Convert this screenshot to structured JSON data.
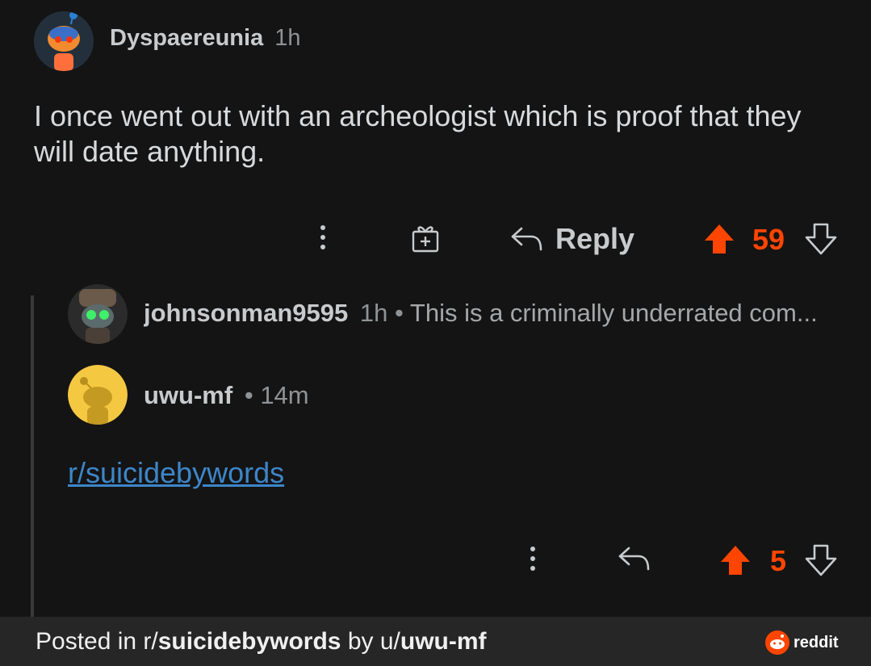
{
  "comment": {
    "author": "Dyspaereunia",
    "time": "1h",
    "body": "I once went out with an archeologist which is proof that they will date anything.",
    "reply_label": "Reply",
    "score": "59"
  },
  "collapsed_reply": {
    "author": "johnsonman9595",
    "time": "1h",
    "separator": "•",
    "preview": "This is a criminally underrated com..."
  },
  "reply": {
    "author": "uwu-mf",
    "separator": "•",
    "time": "14m",
    "link_text": "r/suicidebywords",
    "score": "5"
  },
  "footer": {
    "posted_in": "Posted in r/",
    "subreddit": "suicidebywords",
    "by": "by u/",
    "user": "uwu-mf",
    "brand": "reddit"
  },
  "colors": {
    "background": "#141414",
    "upvote": "#ff4500",
    "link": "#3d86c9",
    "footer_bg": "#262626"
  },
  "icons": [
    "more-vert-icon",
    "gift-award-icon",
    "reply-arrow-icon",
    "upvote-arrow-icon",
    "downvote-arrow-icon",
    "reddit-logo-icon"
  ]
}
